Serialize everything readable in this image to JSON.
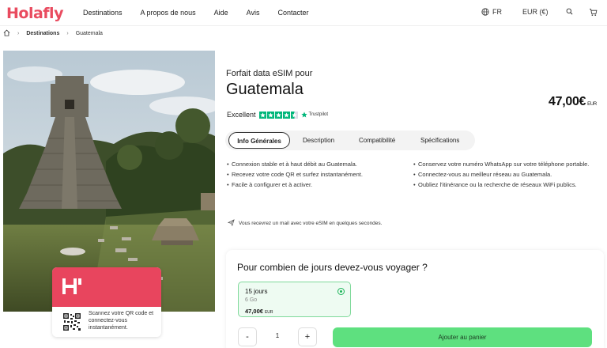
{
  "header": {
    "logo": "Holafly",
    "nav": [
      "Destinations",
      "A propos de nous",
      "Aide",
      "Avis",
      "Contacter"
    ],
    "language": "FR",
    "currency": "EUR (€)",
    "icons": [
      "globe-icon",
      "search-icon",
      "cart-icon"
    ]
  },
  "breadcrumb": {
    "home_icon": "home-icon",
    "items": [
      "Destinations",
      "Guatemala"
    ]
  },
  "hero": {
    "image": "mayan-temple-photo",
    "qr_card": {
      "logo_icon": "holafly-h-icon",
      "text": "Scannez votre QR code et connectez-vous instantanément."
    }
  },
  "product": {
    "subtitle": "Forfait data eSIM pour",
    "title": "Guatemala",
    "price": "47,00€",
    "price_currency": "EUR",
    "rating_label": "Excellent",
    "rating_stars": 4.5,
    "trustpilot_label": "Trustpilot"
  },
  "tabs": [
    "Info Générales",
    "Description",
    "Compatibilité",
    "Spécifications"
  ],
  "active_tab": "Info Générales",
  "features": {
    "left": [
      "Connexion stable et à haut débit au Guatemala.",
      "Recevez votre code QR et surfez instantanément.",
      "Facile à configurer et à activer."
    ],
    "right": [
      "Conservez votre numéro WhatsApp sur votre téléphone portable.",
      "Connectez-vous au meilleur réseau au Guatemala.",
      "Oubliez l'itinérance ou la recherche de réseaux WiFi publics."
    ]
  },
  "mail_note": "Vous recevrez un mail avec votre eSIM en quelques secondes.",
  "plan_section": {
    "question": "Pour combien de jours devez-vous voyager ?",
    "plan": {
      "days": "15 jours",
      "data": "6 Go",
      "price": "47,00€",
      "currency": "EUR"
    },
    "quantity": "1",
    "minus_label": "-",
    "plus_label": "+",
    "add_to_cart": "Ajouter au panier"
  },
  "colors": {
    "brand": "#e94b5f",
    "trustpilot": "#00b67a",
    "cta": "#5ee07f",
    "plan_border": "#7fd99a"
  }
}
